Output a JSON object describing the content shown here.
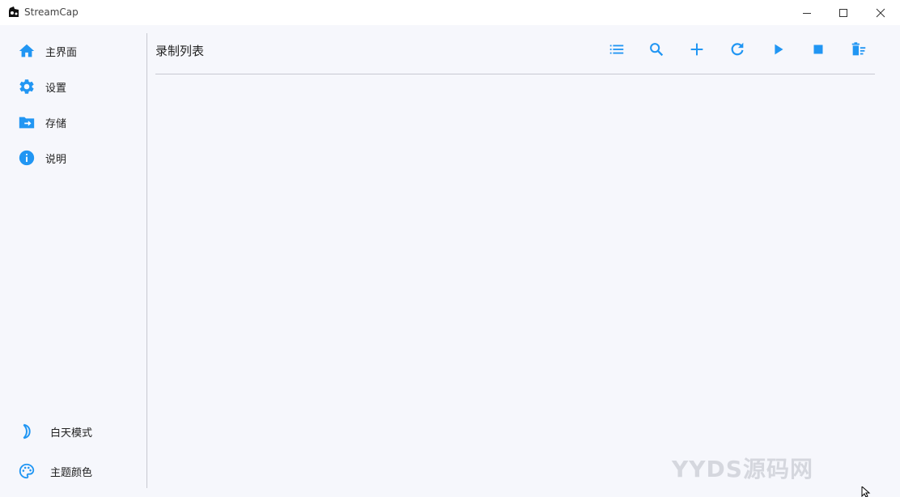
{
  "window": {
    "title": "StreamCap",
    "controls": [
      "minimize",
      "maximize",
      "close"
    ]
  },
  "sidebar": {
    "items": [
      {
        "label": "主界面",
        "icon": "home-icon"
      },
      {
        "label": "设置",
        "icon": "gear-icon"
      },
      {
        "label": "存储",
        "icon": "folder-arrow-icon"
      },
      {
        "label": "说明",
        "icon": "info-icon"
      }
    ],
    "bottom": [
      {
        "label": "白天模式",
        "icon": "moon-icon"
      },
      {
        "label": "主题颜色",
        "icon": "palette-icon"
      }
    ]
  },
  "main": {
    "title": "录制列表",
    "toolbar": [
      {
        "icon": "list-icon"
      },
      {
        "icon": "search-icon"
      },
      {
        "icon": "add-icon"
      },
      {
        "icon": "refresh-icon"
      },
      {
        "icon": "play-icon"
      },
      {
        "icon": "stop-icon"
      },
      {
        "icon": "delete-sweep-icon"
      }
    ]
  },
  "watermark": "YYDS源码网",
  "colors": {
    "accent": "#2196f3",
    "background": "#f6f7fc",
    "titlebar": "#ffffff",
    "divider": "#c7c9d1"
  }
}
